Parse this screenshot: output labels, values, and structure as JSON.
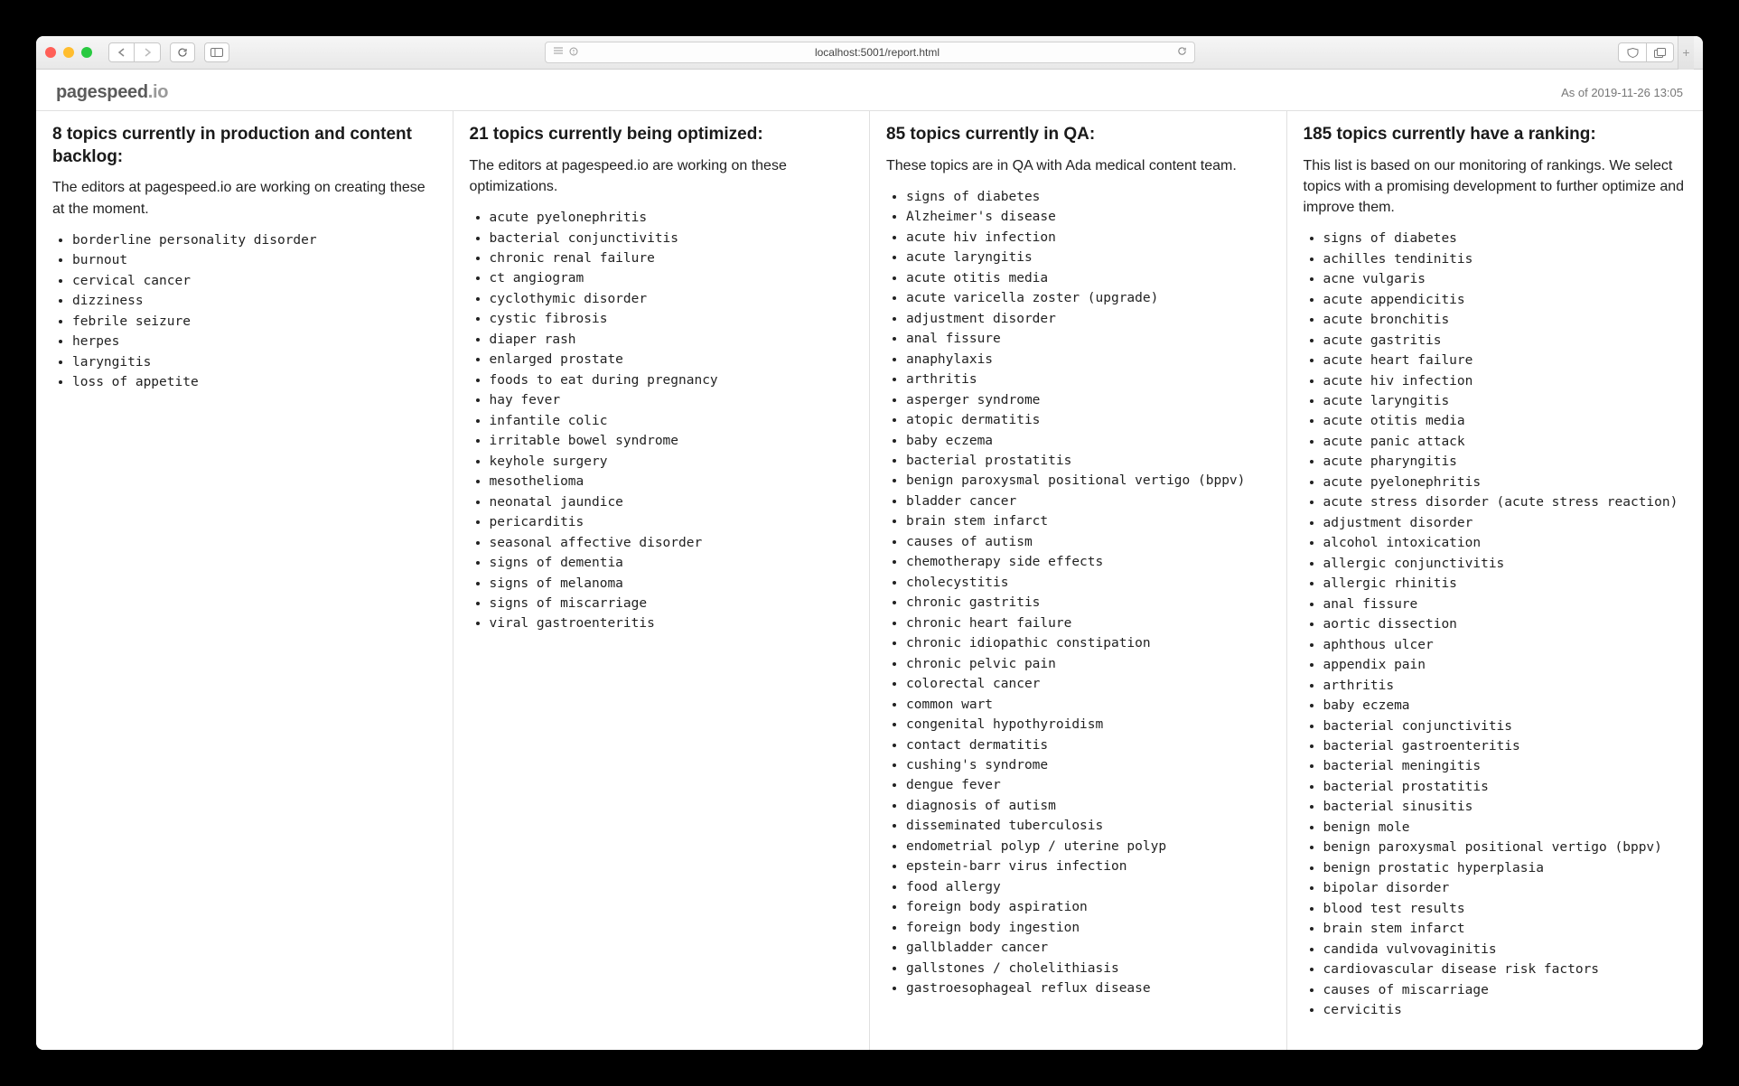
{
  "browser": {
    "url": "localhost:5001/report.html"
  },
  "page": {
    "logo_main": "pagespeed",
    "logo_suffix": ".io",
    "timestamp": "As of 2019-11-26 13:05"
  },
  "columns": [
    {
      "title": "8 topics currently in production and content backlog:",
      "desc": "The editors at pagespeed.io are working on creating these at the moment.",
      "items": [
        "borderline personality disorder",
        "burnout",
        "cervical cancer",
        "dizziness",
        "febrile seizure",
        "herpes",
        "laryngitis",
        "loss of appetite"
      ]
    },
    {
      "title": "21 topics currently being optimized:",
      "desc": "The editors at pagespeed.io are working on these optimizations.",
      "items": [
        "acute pyelonephritis",
        "bacterial conjunctivitis",
        "chronic renal failure",
        "ct angiogram",
        "cyclothymic disorder",
        "cystic fibrosis",
        "diaper rash",
        "enlarged prostate",
        "foods to eat during pregnancy",
        "hay fever",
        "infantile colic",
        "irritable bowel syndrome",
        "keyhole surgery",
        "mesothelioma",
        "neonatal jaundice",
        "pericarditis",
        "seasonal affective disorder",
        "signs of dementia",
        "signs of melanoma",
        "signs of miscarriage",
        "viral gastroenteritis"
      ]
    },
    {
      "title": "85 topics currently in QA:",
      "desc": "These topics are in QA with Ada medical content team.",
      "items": [
        "signs of diabetes",
        "Alzheimer's disease",
        "acute hiv infection",
        "acute laryngitis",
        "acute otitis media",
        "acute varicella zoster (upgrade)",
        "adjustment disorder",
        "anal fissure",
        "anaphylaxis",
        "arthritis",
        "asperger syndrome",
        "atopic dermatitis",
        "baby eczema",
        "bacterial prostatitis",
        "benign paroxysmal positional vertigo (bppv)",
        "bladder cancer",
        "brain stem infarct",
        "causes of autism",
        "chemotherapy side effects",
        "cholecystitis",
        "chronic gastritis",
        "chronic heart failure",
        "chronic idiopathic constipation",
        "chronic pelvic pain",
        "colorectal cancer",
        "common wart",
        "congenital hypothyroidism",
        "contact dermatitis",
        "cushing's syndrome",
        "dengue fever",
        "diagnosis of autism",
        "disseminated tuberculosis",
        "endometrial polyp / uterine polyp",
        "epstein-barr virus infection",
        "food allergy",
        "foreign body aspiration",
        "foreign body ingestion",
        "gallbladder cancer",
        "gallstones / cholelithiasis",
        "gastroesophageal reflux disease"
      ]
    },
    {
      "title": "185 topics currently have a ranking:",
      "desc": "This list is based on our monitoring of rankings. We select topics with a promising development to further optimize and improve them.",
      "items": [
        "signs of diabetes",
        "achilles tendinitis",
        "acne vulgaris",
        "acute appendicitis",
        "acute bronchitis",
        "acute gastritis",
        "acute heart failure",
        "acute hiv infection",
        "acute laryngitis",
        "acute otitis media",
        "acute panic attack",
        "acute pharyngitis",
        "acute pyelonephritis",
        "acute stress disorder (acute stress reaction)",
        "adjustment disorder",
        "alcohol intoxication",
        "allergic conjunctivitis",
        "allergic rhinitis",
        "anal fissure",
        "aortic dissection",
        "aphthous ulcer",
        "appendix pain",
        "arthritis",
        "baby eczema",
        "bacterial conjunctivitis",
        "bacterial gastroenteritis",
        "bacterial meningitis",
        "bacterial prostatitis",
        "bacterial sinusitis",
        "benign mole",
        "benign paroxysmal positional vertigo (bppv)",
        "benign prostatic hyperplasia",
        "bipolar disorder",
        "blood test results",
        "brain stem infarct",
        "candida vulvovaginitis",
        "cardiovascular disease risk factors",
        "causes of miscarriage",
        "cervicitis"
      ]
    }
  ]
}
